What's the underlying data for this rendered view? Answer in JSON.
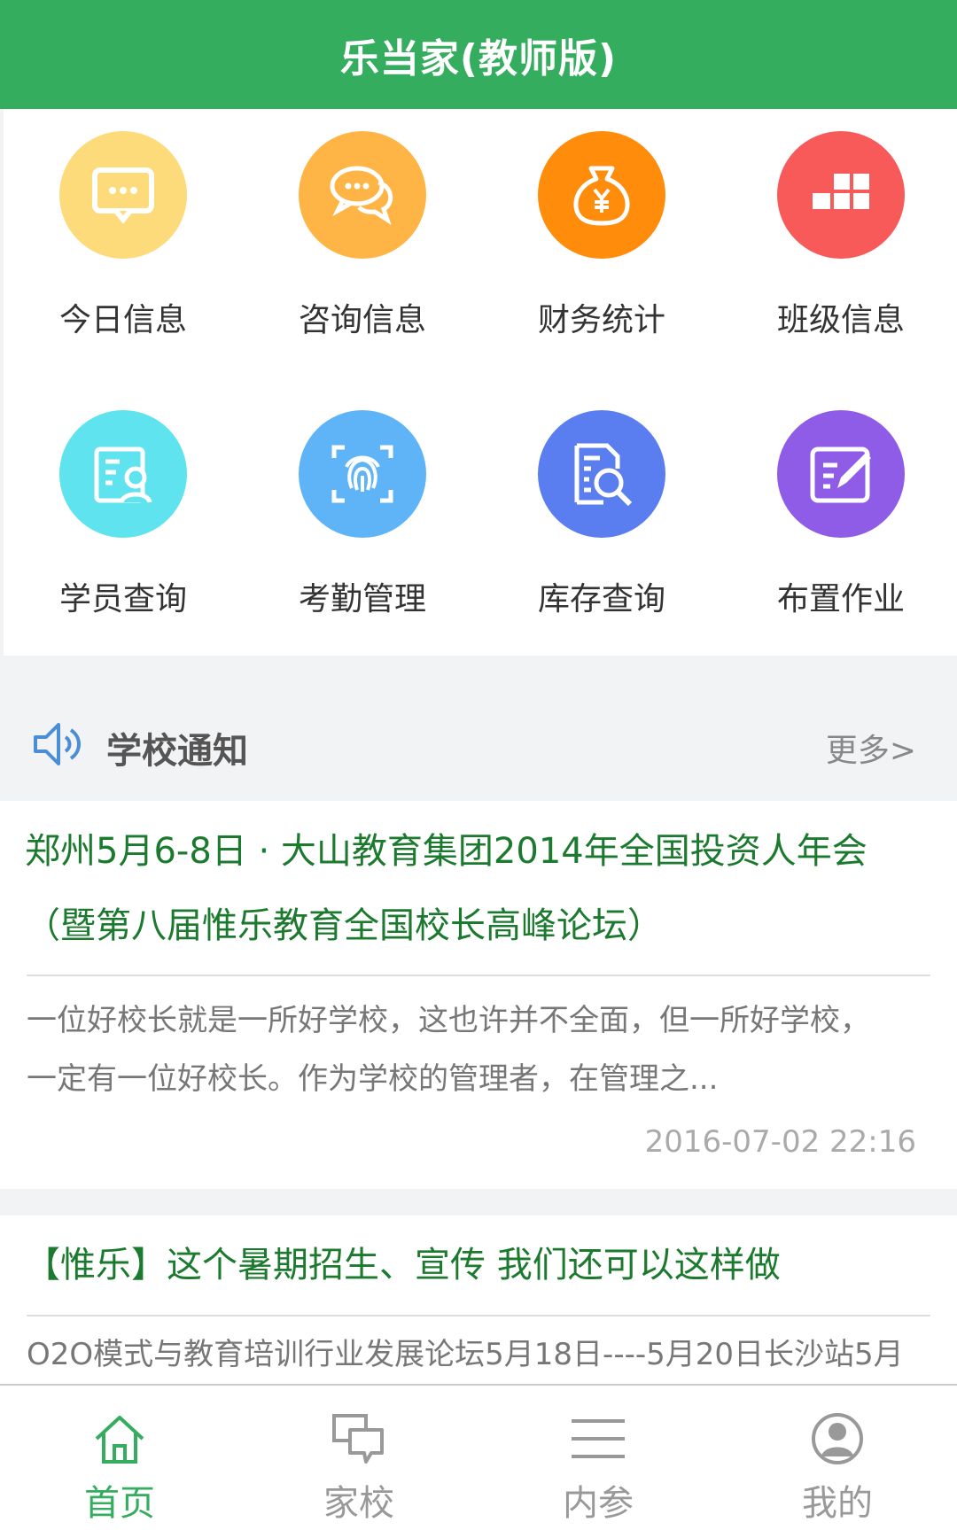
{
  "header": {
    "title": "乐当家(教师版)"
  },
  "grid": [
    {
      "label": "今日信息",
      "icon": "chat-bubble-icon",
      "color": "#fddb7a"
    },
    {
      "label": "咨询信息",
      "icon": "dialog-bubbles-icon",
      "color": "#ffb545"
    },
    {
      "label": "财务统计",
      "icon": "money-bag-icon",
      "color": "#ff8c0a"
    },
    {
      "label": "班级信息",
      "icon": "blocks-icon",
      "color": "#f85a5a"
    },
    {
      "label": "学员查询",
      "icon": "student-card-icon",
      "color": "#5ee3ef"
    },
    {
      "label": "考勤管理",
      "icon": "fingerprint-icon",
      "color": "#5fb4f7"
    },
    {
      "label": "库存查询",
      "icon": "document-search-icon",
      "color": "#5a7ef0"
    },
    {
      "label": "布置作业",
      "icon": "edit-form-icon",
      "color": "#8f5ce8"
    }
  ],
  "notice": {
    "title": "学校通知",
    "more": "更多>",
    "icon": "speaker-icon"
  },
  "articles": [
    {
      "title_line1": "郑州5月6-8日 · 大山教育集团2014年全国投资人年会",
      "title_line2": "（暨第八届惟乐教育全国校长高峰论坛）",
      "desc_line1": "一位好校长就是一所好学校，这也许并不全面，但一所好学校，",
      "desc_line2": "一定有一位好校长。作为学校的管理者，在管理之...",
      "time": "2016-07-02 22:16"
    },
    {
      "title_line1": "【惟乐】这个暑期招生、宣传 我们还可以这样做",
      "desc_line1": "O2O模式与教育培训行业发展论坛5月18日----5月20日长沙站5月"
    }
  ],
  "tabs": [
    {
      "label": "首页",
      "icon": "home-icon",
      "active": true
    },
    {
      "label": "家校",
      "icon": "chat-icon",
      "active": false
    },
    {
      "label": "内参",
      "icon": "menu-lines-icon",
      "active": false
    },
    {
      "label": "我的",
      "icon": "user-icon",
      "active": false
    }
  ],
  "colors": {
    "brand_green": "#35ad5f",
    "title_green": "#1c7a2f"
  }
}
